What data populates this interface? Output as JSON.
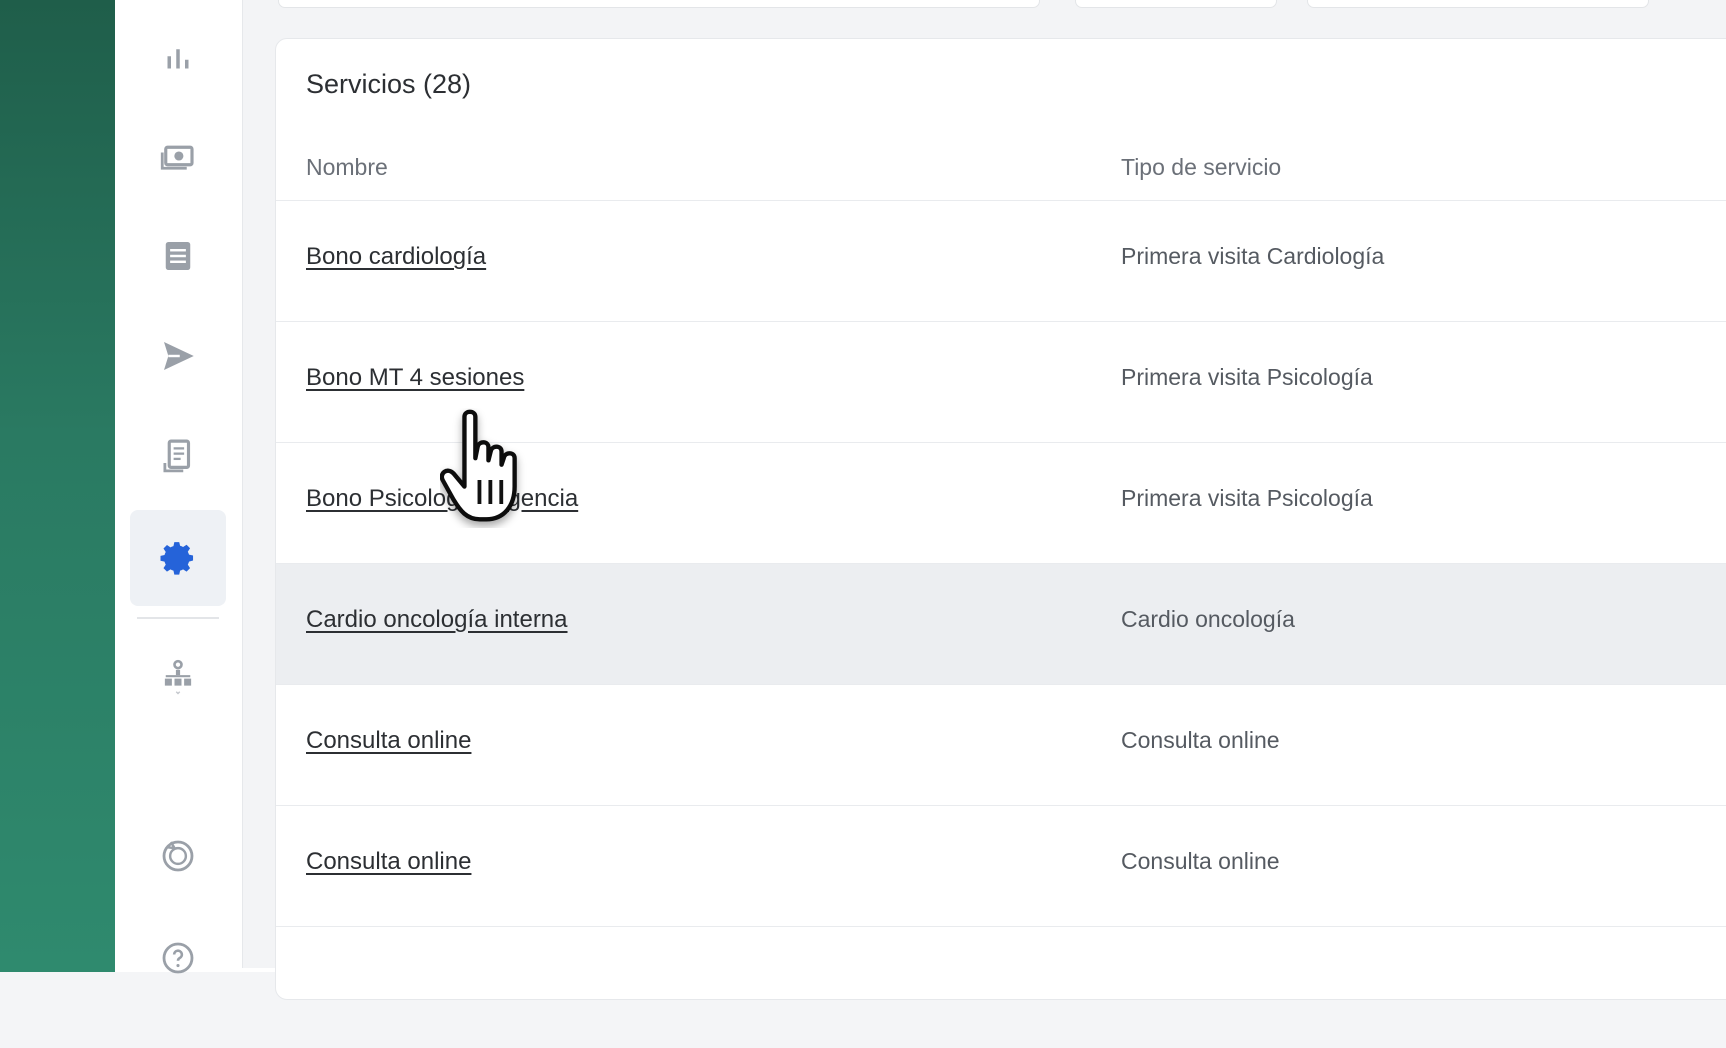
{
  "sidebar": {
    "items": [
      {
        "icon": "bar-chart-icon",
        "active": false
      },
      {
        "icon": "cash-icon",
        "active": false
      },
      {
        "icon": "list-icon",
        "active": false
      },
      {
        "icon": "send-icon",
        "active": false
      },
      {
        "icon": "receipt-icon",
        "active": false
      },
      {
        "icon": "gear-icon",
        "active": true
      },
      {
        "icon": "org-chart-icon",
        "active": false
      },
      {
        "icon": "history-icon",
        "active": false
      },
      {
        "icon": "help-icon",
        "active": false
      }
    ],
    "active_color": "#2563d9",
    "icon_color": "#9aa0a8"
  },
  "services": {
    "title": "Servicios (28)",
    "columns": {
      "name": "Nombre",
      "type": "Tipo de servicio"
    },
    "rows": [
      {
        "name": "Bono cardiología",
        "type": "Primera visita Cardiología"
      },
      {
        "name": "Bono MT 4 sesiones",
        "type": "Primera visita Psicología"
      },
      {
        "name": "Bono Psicología urgencia",
        "type": "Primera visita Psicología"
      },
      {
        "name": "Cardio oncología interna",
        "type": "Cardio oncología"
      },
      {
        "name": "Consulta online",
        "type": "Consulta online"
      },
      {
        "name": "Consulta online",
        "type": "Consulta online"
      }
    ],
    "highlighted_row_index": 3
  },
  "colors": {
    "brand_green": "#2a7a62",
    "accent_blue": "#2563d9"
  }
}
